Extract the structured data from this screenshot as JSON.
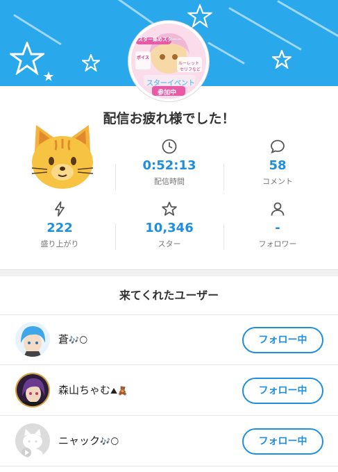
{
  "colors": {
    "accent": "#1d8ee0",
    "banner": "#29a8ec",
    "divider": "#e6e6e6"
  },
  "header": {
    "avatar_icon": "streamer-avatar",
    "avatar_text": [
      "スター集めスターー",
      "ボイス",
      "ルーレット",
      "セリフなど",
      "スターイベント",
      "参加中"
    ]
  },
  "summary": {
    "title": "配信お疲れ様でした！",
    "mascot_icon": "cat-face-icon",
    "stats": [
      {
        "icon": "clock-icon",
        "value": "0:52:13",
        "label": "配信時間"
      },
      {
        "icon": "comment-icon",
        "value": "58",
        "label": "コメント"
      },
      {
        "icon": "lightning-icon",
        "value": "222",
        "label": "盛り上がり"
      },
      {
        "icon": "star-icon",
        "value": "10,346",
        "label": "スター"
      },
      {
        "icon": "person-icon",
        "value": "-",
        "label": "フォロワー"
      }
    ]
  },
  "visitors": {
    "title": "来てくれたユーザー",
    "users": [
      {
        "name": "蒼",
        "emoji": "🎶🌕",
        "button": "フォロー中",
        "avatar": "blue-hair-avatar"
      },
      {
        "name": "森山ちゃむ",
        "emoji": "⛰🧸",
        "button": "フォロー中",
        "avatar": "purple-hair-avatar"
      },
      {
        "name": "ニャック",
        "emoji": "🎶🌕",
        "button": "フォロー中",
        "avatar": "default-cat-avatar"
      }
    ]
  }
}
